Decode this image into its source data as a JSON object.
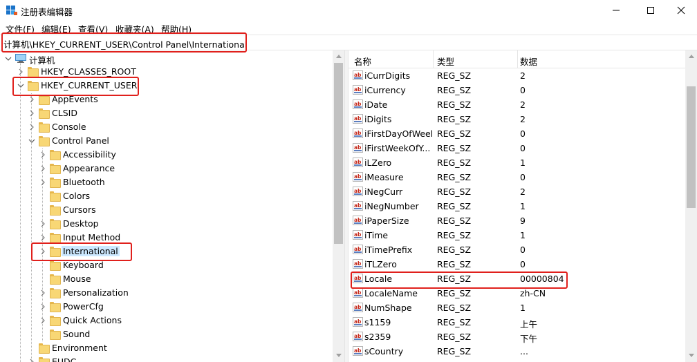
{
  "window": {
    "title": "注册表编辑器",
    "minimize_glyph": "—",
    "maximize_glyph": "☐",
    "close_glyph": "✕"
  },
  "menu": {
    "items": [
      {
        "label": "文件(F)"
      },
      {
        "label": "编辑(E)"
      },
      {
        "label": "查看(V)"
      },
      {
        "label": "收藏夹(A)"
      },
      {
        "label": "帮助(H)"
      }
    ]
  },
  "address": {
    "path": "计算机\\HKEY_CURRENT_USER\\Control Panel\\International"
  },
  "tree": {
    "root": "计算机",
    "hives": [
      {
        "label": "HKEY_CLASSES_ROOT"
      },
      {
        "label": "HKEY_CURRENT_USER"
      }
    ],
    "hkcu_children": [
      {
        "label": "AppEvents"
      },
      {
        "label": "CLSID"
      },
      {
        "label": "Console"
      },
      {
        "label": "Control Panel"
      }
    ],
    "control_panel_children": [
      {
        "label": "Accessibility"
      },
      {
        "label": "Appearance"
      },
      {
        "label": "Bluetooth"
      },
      {
        "label": "Colors"
      },
      {
        "label": "Cursors"
      },
      {
        "label": "Desktop"
      },
      {
        "label": "Input Method"
      },
      {
        "label": "International"
      },
      {
        "label": "Keyboard"
      },
      {
        "label": "Mouse"
      },
      {
        "label": "Personalization"
      },
      {
        "label": "PowerCfg"
      },
      {
        "label": "Quick Actions"
      },
      {
        "label": "Sound"
      }
    ],
    "after": [
      {
        "label": "Environment"
      },
      {
        "label": "EUDC"
      }
    ],
    "selected": "International"
  },
  "values": {
    "columns": {
      "name": "名称",
      "type": "类型",
      "data": "数据"
    },
    "icon": "ab",
    "rows": [
      {
        "name": "iCurrDigits",
        "type": "REG_SZ",
        "data": "2"
      },
      {
        "name": "iCurrency",
        "type": "REG_SZ",
        "data": "0"
      },
      {
        "name": "iDate",
        "type": "REG_SZ",
        "data": "2"
      },
      {
        "name": "iDigits",
        "type": "REG_SZ",
        "data": "2"
      },
      {
        "name": "iFirstDayOfWeek",
        "type": "REG_SZ",
        "data": "0"
      },
      {
        "name": "iFirstWeekOfY...",
        "type": "REG_SZ",
        "data": "0"
      },
      {
        "name": "iLZero",
        "type": "REG_SZ",
        "data": "1"
      },
      {
        "name": "iMeasure",
        "type": "REG_SZ",
        "data": "0"
      },
      {
        "name": "iNegCurr",
        "type": "REG_SZ",
        "data": "2"
      },
      {
        "name": "iNegNumber",
        "type": "REG_SZ",
        "data": "1"
      },
      {
        "name": "iPaperSize",
        "type": "REG_SZ",
        "data": "9"
      },
      {
        "name": "iTime",
        "type": "REG_SZ",
        "data": "1"
      },
      {
        "name": "iTimePrefix",
        "type": "REG_SZ",
        "data": "0"
      },
      {
        "name": "iTLZero",
        "type": "REG_SZ",
        "data": "0"
      },
      {
        "name": "Locale",
        "type": "REG_SZ",
        "data": "00000804"
      },
      {
        "name": "LocaleName",
        "type": "REG_SZ",
        "data": "zh-CN"
      },
      {
        "name": "NumShape",
        "type": "REG_SZ",
        "data": "1"
      },
      {
        "name": "s1159",
        "type": "REG_SZ",
        "data": "上午"
      },
      {
        "name": "s2359",
        "type": "REG_SZ",
        "data": "下午"
      },
      {
        "name": "sCountry",
        "type": "REG_SZ",
        "data": "..."
      }
    ]
  },
  "colors": {
    "highlight_red": "#e0201c",
    "selection_blue": "#cce8ff",
    "folder_yellow": "#f8d775"
  }
}
